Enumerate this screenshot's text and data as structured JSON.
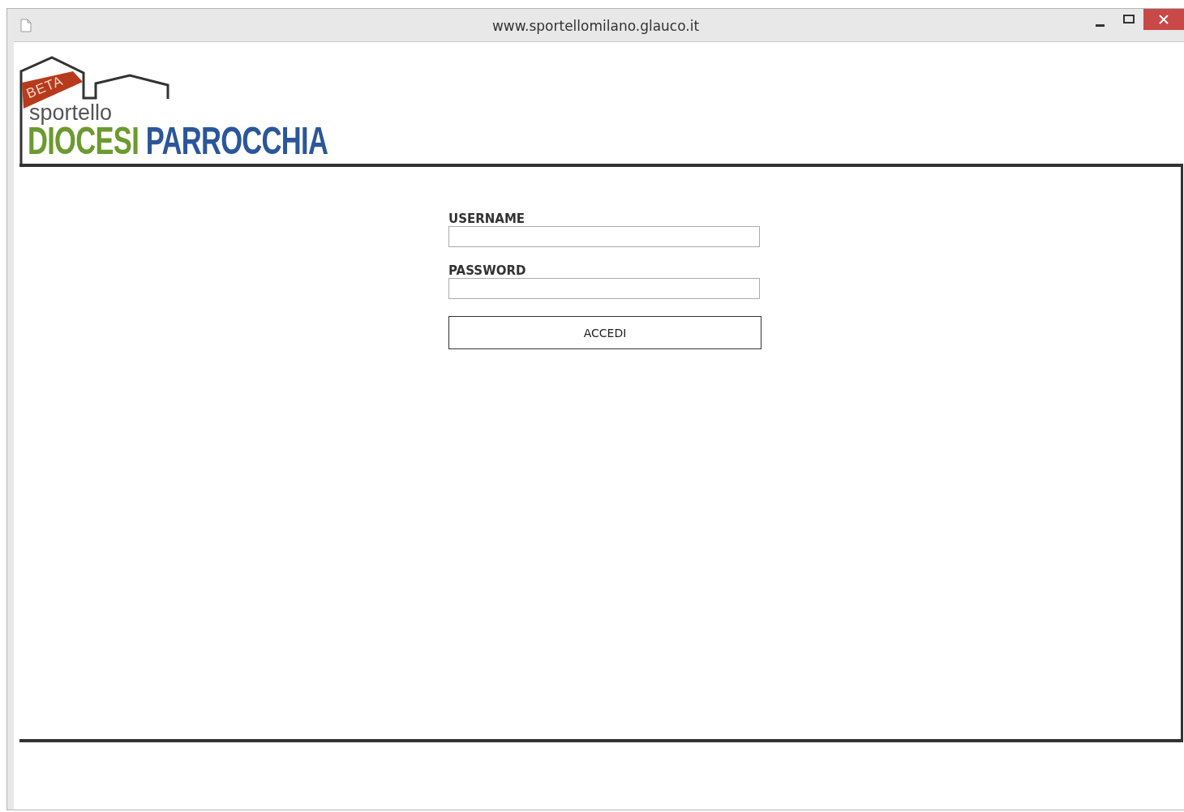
{
  "window": {
    "title": "www.sportellomilano.glauco.it"
  },
  "logo": {
    "badge": "BETA",
    "tagline": "sportello",
    "words": [
      {
        "text": "DIOCESI",
        "color": "#6b9a2e"
      },
      {
        "text": "PARROCCHIA",
        "color": "#2b5699"
      }
    ]
  },
  "form": {
    "fields": [
      {
        "label": "USERNAME"
      },
      {
        "label": "PASSWORD"
      }
    ],
    "button": "ACCEDI"
  }
}
